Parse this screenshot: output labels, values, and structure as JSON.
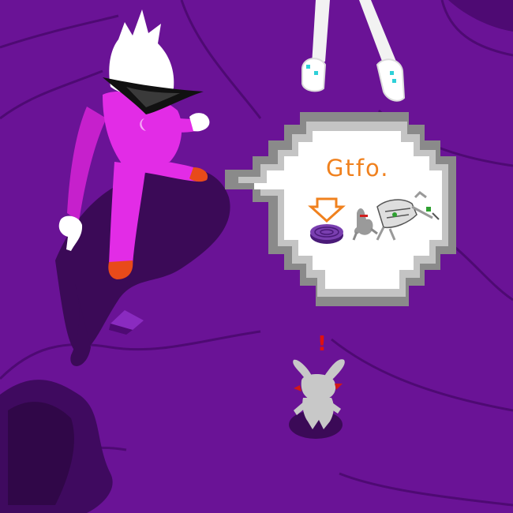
{
  "speech_bubble": {
    "text": "Gtfo.",
    "arrow_icon": "arrow-down-icon",
    "item_icon": "sewer-lid-icon",
    "figure_icon": "knocked-out-robot-icon"
  },
  "alert": {
    "text": "!"
  },
  "colors": {
    "ground": "#6a1396",
    "shadow": "#3b0a57",
    "suit": "#e22ce6",
    "bubble_fill": "#ffffff",
    "bubble_border": "#8a8a8a",
    "accent_orange": "#f0811e",
    "alert_red": "#e01010",
    "critter_gray": "#c8c8c8"
  }
}
